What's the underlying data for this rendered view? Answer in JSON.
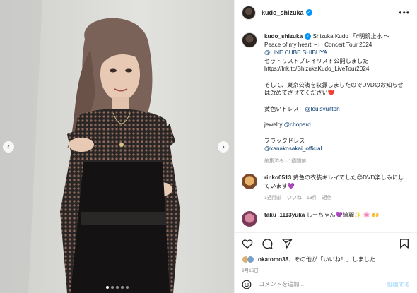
{
  "post": {
    "username": "kudo_shizuka",
    "more_icon": "more-icon"
  },
  "caption": {
    "username": "kudo_shizuka",
    "line1": "Shizuka Kudo 「#明鏡止水 〜Peace of my heart〜」 Concert Tour 2024",
    "venue": "@LINE CUBE SHIBUYA",
    "line2": "セットリストプレイリスト公開しました！",
    "url": "https://lnk.to/ShizukaKudo_LiveTour2024",
    "line3": "そして、東京公演を収録しましたのでDVDのお知らせは改めてさせてください❤️",
    "dress1_label": "黄色いドレス",
    "dress1_tag": "@louisvuitton",
    "jewelry_label": "jewelry",
    "jewelry_tag": "@chopard",
    "dress2_label": "ブラックドレス",
    "dress2_tag": "@kanakosakai_official",
    "meta": "編集済み · 1週間前"
  },
  "comments": [
    {
      "username": "rinko0513",
      "text": "黄色の衣装キレイでした😍DVD楽しみにしています💜",
      "meta": "1週間前　いいね！19件　返信"
    },
    {
      "username": "taku_1113yuka",
      "text": "しーちゃん💜綺麗✨ 🌸 🙌"
    }
  ],
  "likes": {
    "user": "okatomo38",
    "text": "、その他が「いいね！」しました"
  },
  "date": "9月16日",
  "comment_bar": {
    "placeholder": "コメントを追加...",
    "post_label": "投稿する"
  },
  "colors": {
    "accent": "#0095f6",
    "link": "#00376b",
    "muted": "#8e8e8e",
    "post_disabled": "#b2dffc"
  },
  "carousel": {
    "total": 5,
    "active": 1
  }
}
